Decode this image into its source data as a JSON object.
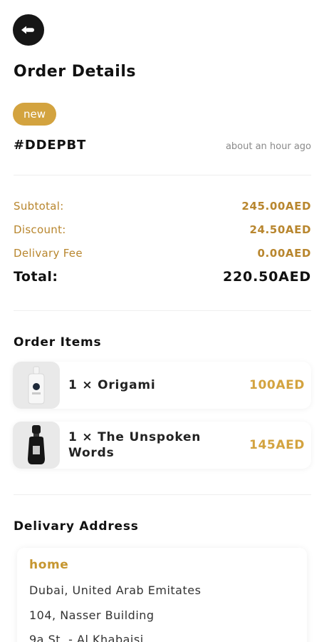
{
  "header": {
    "title": "Order Details"
  },
  "order": {
    "status": "new",
    "id": "#DDEPBT",
    "time": "about an hour ago"
  },
  "summary": {
    "subtotal_label": "Subtotal:",
    "subtotal_value": "245.00AED",
    "discount_label": "Discount:",
    "discount_value": "24.50AED",
    "delivery_label": "Delivary Fee",
    "delivery_value": "0.00AED",
    "total_label": "Total:",
    "total_value": "220.50AED"
  },
  "items_section": {
    "title": "Order Items",
    "items": [
      {
        "name": "1 × Origami",
        "price": "100AED"
      },
      {
        "name": "1 × The Unspoken Words",
        "price": "145AED"
      }
    ]
  },
  "address": {
    "title": "Delivary Address",
    "label": "home",
    "line1": "Dubai, United Arab Emitates",
    "line2": "104, Nasser Building",
    "line3": "9a St. - Al Khabaisi"
  },
  "colors": {
    "accent": "#d3a33f",
    "accent_text": "#b8862e",
    "back_button": "#161616"
  },
  "icons": {
    "back": "back-arrow-icon"
  }
}
